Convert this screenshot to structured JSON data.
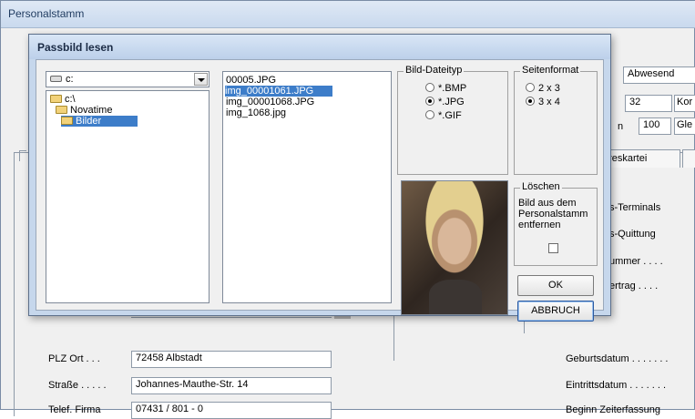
{
  "background_window": {
    "title": "Personalstamm",
    "right_fields": {
      "status": "Abwesend",
      "number": "32",
      "number_suffix": "Kor",
      "percent_prefix": "n",
      "percent": "100",
      "percent_suffix": "Gle"
    },
    "tab_visible": "hreskartei",
    "side_labels": [
      "s-Terminals",
      "s-Quittung",
      "ummer . . . .",
      "ertrag . . . ."
    ],
    "form": {
      "plz_label": "PLZ Ort . . .",
      "plz_value": "72458 Albstadt",
      "street_label": "Straße . . . . .",
      "street_value": "Johannes-Mauthe-Str. 14",
      "phone_label": "Telef. Firma",
      "phone_value": "07431 / 801 - 0",
      "birth_label": "Geburtsdatum . . . . . . .",
      "entry_label": "Eintrittsdatum . . . . . . .",
      "time_label": "Beginn Zeiterfassung"
    }
  },
  "dialog": {
    "title": "Passbild lesen",
    "drive": "c:",
    "folders": [
      "c:\\",
      "Novatime",
      "Bilder"
    ],
    "files": [
      "00005.JPG",
      "img_00001061.JPG",
      "img_00001068.JPG",
      "img_1068.jpg"
    ],
    "selected_file_index": 1,
    "filetype": {
      "title": "Bild-Dateityp",
      "options": [
        "*.BMP",
        "*.JPG",
        "*.GIF"
      ],
      "selected": "*.JPG"
    },
    "format": {
      "title": "Seitenformat",
      "options": [
        "2 x 3",
        "3 x 4"
      ],
      "selected": "3 x 4"
    },
    "delete": {
      "title": "Löschen",
      "text": "Bild aus dem Personalstamm entfernen",
      "checked": false
    },
    "ok_label": "OK",
    "cancel_label": "ABBRUCH"
  }
}
